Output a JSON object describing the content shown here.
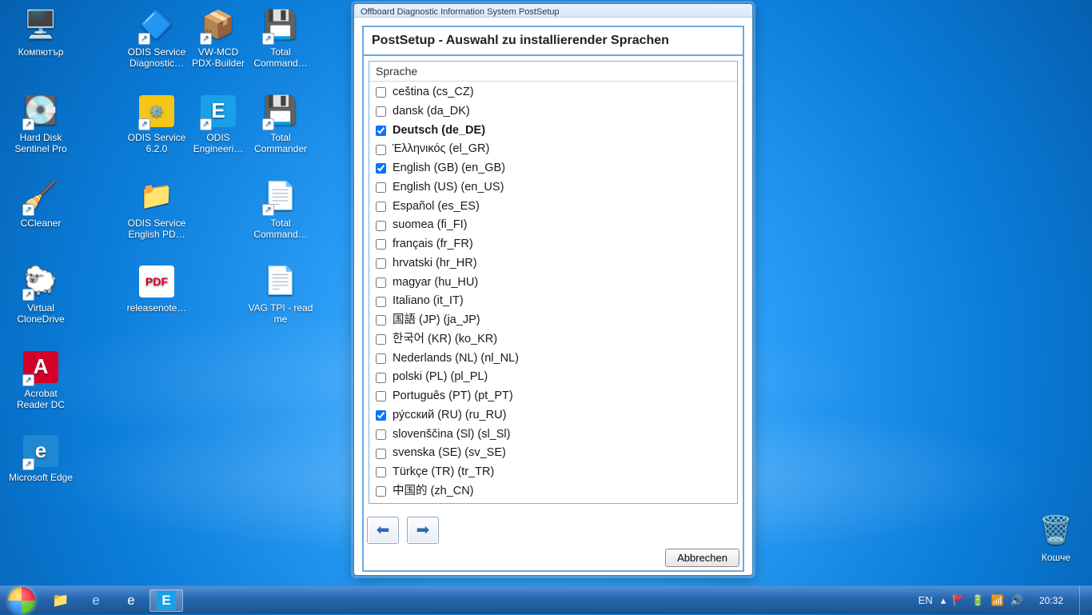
{
  "desktop_icons": [
    {
      "id": "computer",
      "label": "Компютър",
      "col": 0,
      "row": 0,
      "glyph": "🖥️",
      "shortcut": false
    },
    {
      "id": "hdsentinel",
      "label": "Hard Disk Sentinel Pro",
      "col": 0,
      "row": 1,
      "glyph": "💽",
      "shortcut": true
    },
    {
      "id": "ccleaner",
      "label": "CCleaner",
      "col": 0,
      "row": 2,
      "glyph": "🧹",
      "shortcut": true
    },
    {
      "id": "vcd",
      "label": "Virtual CloneDrive",
      "col": 0,
      "row": 3,
      "glyph": "🐑",
      "shortcut": true
    },
    {
      "id": "acrobat",
      "label": "Acrobat Reader DC",
      "col": 0,
      "row": 4,
      "glyph": "A",
      "bg": "#d4002a",
      "shortcut": true
    },
    {
      "id": "edge",
      "label": "Microsoft Edge",
      "col": 0,
      "row": 5,
      "glyph": "e",
      "bg": "#1e88d2",
      "shortcut": true
    },
    {
      "id": "odis-diag",
      "label": "ODIS Service Diagnostic…",
      "col": 1,
      "row": 0,
      "glyph": "🔷",
      "shortcut": true
    },
    {
      "id": "odis-620",
      "label": "ODIS Service 6.2.0",
      "col": 1,
      "row": 1,
      "glyph": "⚙️",
      "bg": "#f5c518",
      "shortcut": true
    },
    {
      "id": "odis-pd",
      "label": "ODIS Service English PD…",
      "col": 1,
      "row": 2,
      "glyph": "📁",
      "shortcut": false
    },
    {
      "id": "relnotes",
      "label": "releasenote…",
      "col": 1,
      "row": 3,
      "glyph": "PDF",
      "bg": "#fff",
      "fg": "#d4002a",
      "shortcut": false
    },
    {
      "id": "vwmcd",
      "label": "VW-MCD PDX-Builder",
      "col": 2,
      "row": 0,
      "glyph": "📦",
      "shortcut": true
    },
    {
      "id": "odis-eng",
      "label": "ODIS Engineeri…",
      "col": 2,
      "row": 1,
      "glyph": "E",
      "bg": "#1aa0e8",
      "shortcut": true
    },
    {
      "id": "tc1",
      "label": "Total Command…",
      "col": 3,
      "row": 0,
      "glyph": "💾",
      "shortcut": true
    },
    {
      "id": "tc2",
      "label": "Total Commander",
      "col": 3,
      "row": 1,
      "glyph": "💾",
      "shortcut": true
    },
    {
      "id": "tc3",
      "label": "Total Command…",
      "col": 3,
      "row": 2,
      "glyph": "📄",
      "shortcut": true
    },
    {
      "id": "vagtpi",
      "label": "VAG TPI - read me",
      "col": 3,
      "row": 3,
      "glyph": "📄",
      "shortcut": false
    }
  ],
  "recycle": {
    "label": "Кошче",
    "glyph": "🗑️"
  },
  "dialog": {
    "title": "Offboard Diagnostic Information System PostSetup",
    "panel_header": "PostSetup - Auswahl zu installierender Sprachen",
    "column_header": "Sprache",
    "languages": [
      {
        "label": "ceština  (cs_CZ)",
        "checked": false,
        "bold": false
      },
      {
        "label": "dansk  (da_DK)",
        "checked": false,
        "bold": false
      },
      {
        "label": "Deutsch  (de_DE)",
        "checked": true,
        "bold": true
      },
      {
        "label": "Έλληνικός  (el_GR)",
        "checked": false,
        "bold": false
      },
      {
        "label": "English (GB)  (en_GB)",
        "checked": true,
        "bold": false
      },
      {
        "label": "English (US)  (en_US)",
        "checked": false,
        "bold": false
      },
      {
        "label": "Español  (es_ES)",
        "checked": false,
        "bold": false
      },
      {
        "label": "suomea  (fi_FI)",
        "checked": false,
        "bold": false
      },
      {
        "label": "français  (fr_FR)",
        "checked": false,
        "bold": false
      },
      {
        "label": "hrvatski  (hr_HR)",
        "checked": false,
        "bold": false
      },
      {
        "label": "magyar  (hu_HU)",
        "checked": false,
        "bold": false
      },
      {
        "label": "Italiano  (it_IT)",
        "checked": false,
        "bold": false
      },
      {
        "label": "国語 (JP)  (ja_JP)",
        "checked": false,
        "bold": false
      },
      {
        "label": "한국어 (KR)  (ko_KR)",
        "checked": false,
        "bold": false
      },
      {
        "label": "Nederlands (NL)  (nl_NL)",
        "checked": false,
        "bold": false
      },
      {
        "label": "polski (PL)  (pl_PL)",
        "checked": false,
        "bold": false
      },
      {
        "label": "Português (PT)  (pt_PT)",
        "checked": false,
        "bold": false
      },
      {
        "label": "ру́сский (RU)  (ru_RU)",
        "checked": true,
        "bold": false
      },
      {
        "label": "slovenščina (Sl)  (sl_Sl)",
        "checked": false,
        "bold": false
      },
      {
        "label": "svenska (SE)  (sv_SE)",
        "checked": false,
        "bold": false
      },
      {
        "label": "Türkçe (TR)  (tr_TR)",
        "checked": false,
        "bold": false
      },
      {
        "label": "中国的  (zh_CN)",
        "checked": false,
        "bold": false
      }
    ],
    "cancel_label": "Abbrechen"
  },
  "taskbar": {
    "pinned": [
      {
        "id": "explorer",
        "glyph": "📁"
      },
      {
        "id": "ie",
        "glyph": "е"
      },
      {
        "id": "edge",
        "glyph": "e"
      },
      {
        "id": "odis",
        "glyph": "E",
        "active": true
      }
    ],
    "lang": "EN",
    "tray_icons": [
      "▴",
      "🚩",
      "🔋",
      "📶",
      "🔊"
    ],
    "clock": "20:32"
  }
}
